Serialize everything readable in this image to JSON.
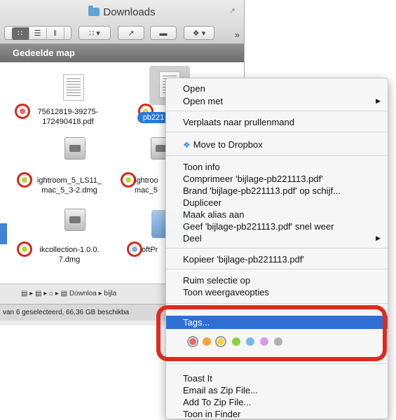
{
  "window": {
    "title": "Downloads",
    "sidebar_heading": "Gedeelde map",
    "pathbar": "Downloa ▸ bijla",
    "status": "van 6 geselecteerd, 66,36 GB beschikba"
  },
  "toolbar": {
    "view_icon": "☰",
    "arrange_label": "▾",
    "share_label": "↗",
    "dropbox_label": "▾",
    "more": "»"
  },
  "files": [
    {
      "label": "75612819-39275-\n172490418.pdf",
      "tag_color": "#e96b6b"
    },
    {
      "label": "pb221",
      "tag_color": "#f2d43b"
    },
    {
      "label": "ightroom_5_LS11_\nmac_5_3-2.dmg",
      "tag_color": "#b9d53a"
    },
    {
      "label": "ightroo\nmac_5",
      "tag_color": "#c9d43a"
    },
    {
      "label": "ikcollection-1.0.0.\n7.dmg",
      "tag_color": "#b9d53a"
    },
    {
      "label": "oftPr",
      "tag_color": "#7fb2e6"
    }
  ],
  "context_menu": {
    "items": [
      {
        "label": "Open"
      },
      {
        "label": "Open met",
        "submenu": true
      },
      {
        "label": "Verplaats naar prullenmand"
      },
      {
        "label": "Move to Dropbox",
        "icon": "dropbox-icon"
      },
      {
        "label": "Toon info"
      },
      {
        "label": "Comprimeer 'bijlage-pb221113.pdf'"
      },
      {
        "label": "Brand 'bijlage-pb221113.pdf' op schijf..."
      },
      {
        "label": "Dupliceer"
      },
      {
        "label": "Maak alias aan"
      },
      {
        "label": "Geef 'bijlage-pb221113.pdf' snel weer"
      },
      {
        "label": "Deel",
        "submenu": true
      },
      {
        "label": "Kopieer 'bijlage-pb221113.pdf'"
      },
      {
        "label": "Ruim selectie op"
      },
      {
        "label": "Toon weergaveopties"
      },
      {
        "label": "Tags..."
      },
      {
        "label": "Toast It"
      },
      {
        "label": "Email as Zip File..."
      },
      {
        "label": "Add To Zip File..."
      },
      {
        "label": "Toon in Finder"
      }
    ],
    "tag_colors": [
      "#e96b6b",
      "#f2a33b",
      "#f2d43b",
      "#8fd13f",
      "#79b7ef",
      "#d59be6",
      "#b0b0b0"
    ],
    "submenu_arrow": "▶"
  },
  "colors": {
    "highlight": "#2e6fd6",
    "callout_red": "#e0291f"
  }
}
